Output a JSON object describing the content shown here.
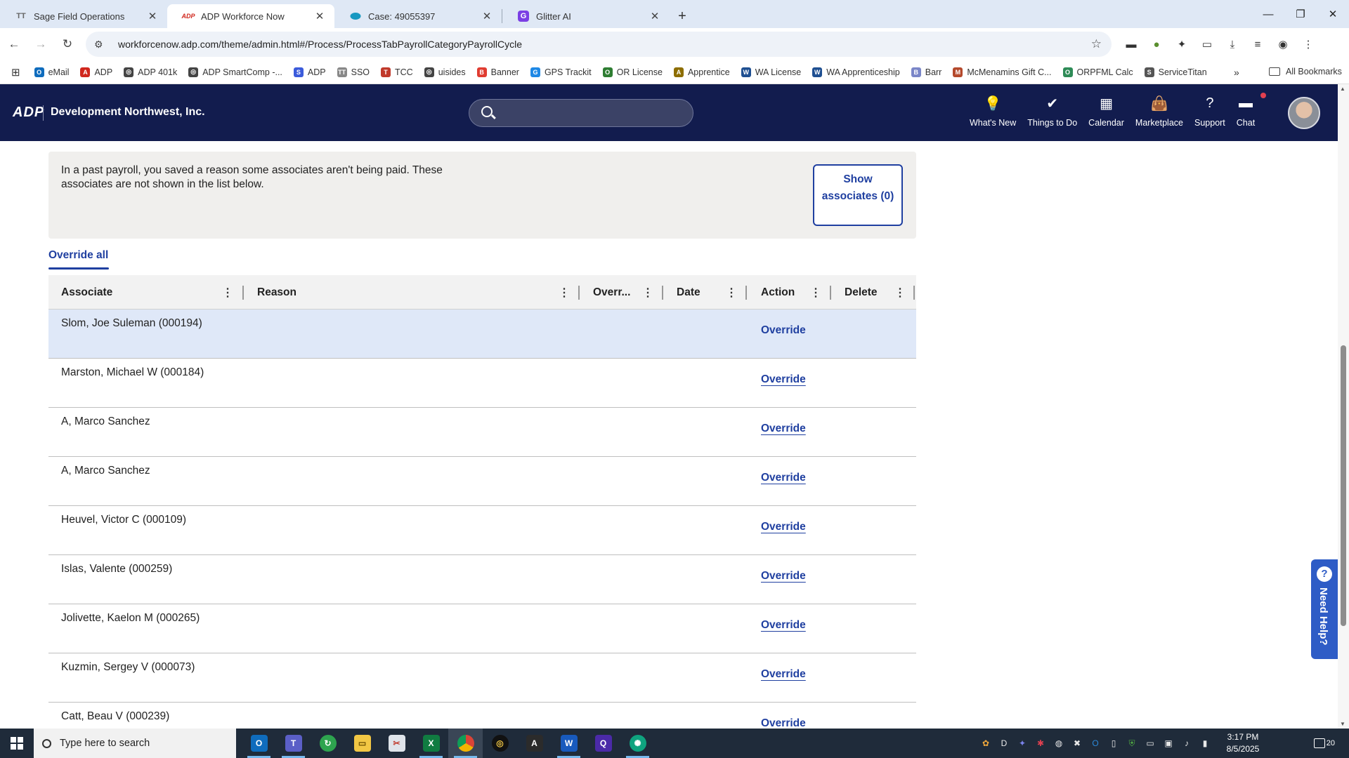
{
  "browser": {
    "tabs": [
      {
        "icon": "tt-icon",
        "favicon_text": "TT",
        "label": "Sage Field Operations"
      },
      {
        "icon": "adp-icon",
        "favicon_text": "ADP",
        "label": "ADP Workforce Now"
      },
      {
        "icon": "salesforce-cloud-icon",
        "favicon_text": "",
        "label": "Case: 49055397"
      },
      {
        "icon": "glitter-g-icon",
        "favicon_text": "G",
        "label": "Glitter AI"
      }
    ],
    "active_tab_index": 1,
    "url": "workforcenow.adp.com/theme/admin.html#/Process/ProcessTabPayrollCategoryPayrollCycle",
    "bookmarks": [
      {
        "label": "eMail",
        "icon_text": "O",
        "color": "#0f6cbd"
      },
      {
        "label": "ADP",
        "icon_text": "A",
        "color": "#d0271d"
      },
      {
        "label": "ADP 401k",
        "icon_text": "◎",
        "color": "#444444"
      },
      {
        "label": "ADP SmartComp -...",
        "icon_text": "◎",
        "color": "#444444"
      },
      {
        "label": "ADP",
        "icon_text": "S",
        "color": "#3b5bdb"
      },
      {
        "label": "SSO",
        "icon_text": "TT",
        "color": "#888888"
      },
      {
        "label": "TCC",
        "icon_text": "T",
        "color": "#c0392b"
      },
      {
        "label": "uisides",
        "icon_text": "◎",
        "color": "#444444"
      },
      {
        "label": "Banner",
        "icon_text": "B",
        "color": "#e03c31"
      },
      {
        "label": "GPS Trackit",
        "icon_text": "G",
        "color": "#1e88e5"
      },
      {
        "label": "OR License",
        "icon_text": "O",
        "color": "#2e7d32"
      },
      {
        "label": "Apprentice",
        "icon_text": "A",
        "color": "#8d6e00"
      },
      {
        "label": "WA License",
        "icon_text": "W",
        "color": "#1e4f91"
      },
      {
        "label": "WA Apprenticeship",
        "icon_text": "W",
        "color": "#1e4f91"
      },
      {
        "label": "Barr",
        "icon_text": "B",
        "color": "#7a86c8"
      },
      {
        "label": "McMenamins Gift C...",
        "icon_text": "M",
        "color": "#b4492c"
      },
      {
        "label": "ORPFML Calc",
        "icon_text": "O",
        "color": "#2e8b57"
      },
      {
        "label": "ServiceTitan",
        "icon_text": "S",
        "color": "#555555"
      }
    ],
    "all_bookmarks_label": "All Bookmarks"
  },
  "adp": {
    "logo_text": "ADP",
    "company": "Development Northwest, Inc.",
    "nav": [
      {
        "label": "What's New",
        "icon": "lightbulb-icon",
        "glyph": "💡",
        "has_dot": false
      },
      {
        "label": "Things to Do",
        "icon": "checkmark-circle-icon",
        "glyph": "✔",
        "has_dot": true
      },
      {
        "label": "Calendar",
        "icon": "calendar-icon",
        "glyph": "▦",
        "has_dot": false
      },
      {
        "label": "Marketplace",
        "icon": "shopping-bag-icon",
        "glyph": "👜",
        "has_dot": false
      },
      {
        "label": "Support",
        "icon": "help-circle-icon",
        "glyph": "?",
        "has_dot": false
      },
      {
        "label": "Chat",
        "icon": "chat-bubble-icon",
        "glyph": "▬",
        "has_dot": false
      }
    ]
  },
  "notice": {
    "text": "In a past payroll, you saved a reason some associates aren't being paid. These associates are not shown in the list below.",
    "button_label": "Show associates (0)"
  },
  "override_all_label": "Override all",
  "table": {
    "columns": [
      {
        "label": "Associate"
      },
      {
        "label": "Reason"
      },
      {
        "label": "Overr..."
      },
      {
        "label": "Date"
      },
      {
        "label": "Action"
      },
      {
        "label": "Delete"
      }
    ],
    "rows": [
      {
        "associate": "Slom, Joe Suleman (000194)",
        "action": "Override",
        "selected": true
      },
      {
        "associate": "Marston, Michael W (000184)",
        "action": "Override",
        "selected": false
      },
      {
        "associate": "A, Marco Sanchez",
        "action": "Override",
        "selected": false
      },
      {
        "associate": "A, Marco Sanchez",
        "action": "Override",
        "selected": false
      },
      {
        "associate": "Heuvel, Victor C (000109)",
        "action": "Override",
        "selected": false
      },
      {
        "associate": "Islas, Valente (000259)",
        "action": "Override",
        "selected": false
      },
      {
        "associate": "Jolivette, Kaelon M (000265)",
        "action": "Override",
        "selected": false
      },
      {
        "associate": "Kuzmin, Sergey V (000073)",
        "action": "Override",
        "selected": false
      },
      {
        "associate": "Catt, Beau V (000239)",
        "action": "Override",
        "selected": false
      }
    ]
  },
  "need_help_label": "Need Help?",
  "taskbar": {
    "search_placeholder": "Type here to search",
    "time": "3:17 PM",
    "date": "8/5/2025",
    "notification_count": "20"
  },
  "colors": {
    "adp_navy": "#121c4e",
    "link_blue": "#1f3fa0",
    "selected_row": "#dfe8f8",
    "notice_bg": "#f0efed"
  }
}
